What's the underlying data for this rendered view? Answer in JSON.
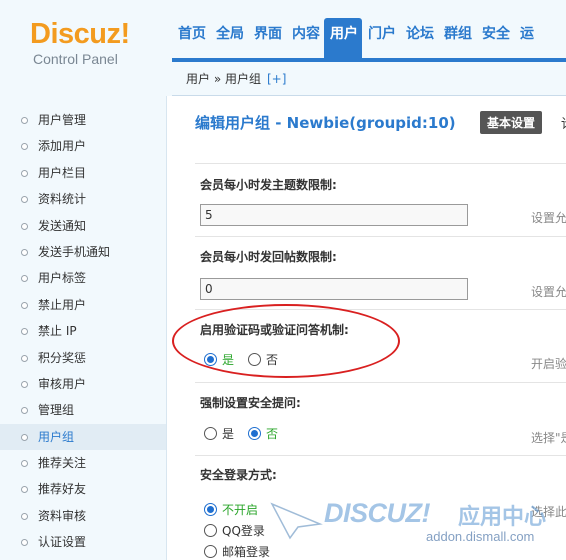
{
  "header": {
    "logo_brand": "Discuz!",
    "logo_sub": "Control Panel",
    "nav": [
      "首页",
      "全局",
      "界面",
      "内容",
      "用户",
      "门户",
      "论坛",
      "群组",
      "安全",
      "运"
    ],
    "active_nav": "用户",
    "breadcrumb": "用户 » 用户组",
    "breadcrumb_plus": "[+]"
  },
  "sidebar": {
    "items": [
      "用户管理",
      "添加用户",
      "用户栏目",
      "资料统计",
      "发送通知",
      "发送手机通知",
      "用户标签",
      "禁止用户",
      "禁止 IP",
      "积分奖惩",
      "审核用户",
      "管理组",
      "用户组",
      "推荐关注",
      "推荐好友",
      "资料审核",
      "认证设置"
    ],
    "active": "用户组"
  },
  "main": {
    "title": "编辑用户组 - Newbie(groupid:10)",
    "basic_button": "基本设置",
    "title_extra": "论",
    "fields": {
      "topic_limit": {
        "label": "会员每小时发主题数限制:",
        "value": "5",
        "hint": "设置允"
      },
      "reply_limit": {
        "label": "会员每小时发回帖数限制:",
        "value": "0",
        "hint": "设置允"
      },
      "captcha": {
        "label": "启用验证码或验证问答机制:",
        "yes": "是",
        "no": "否",
        "selected": "是",
        "hint": "开启验"
      },
      "security_question": {
        "label": "强制设置安全提问:",
        "yes": "是",
        "no": "否",
        "selected": "否",
        "hint": "选择\"是"
      },
      "login_method": {
        "label": "安全登录方式:",
        "options": [
          "不开启",
          "QQ登录",
          "邮箱登录"
        ],
        "selected": "不开启",
        "hint": "选择此"
      }
    }
  },
  "watermark": {
    "brand": "DISCUZ!",
    "cn": "应用中心",
    "url": "addon.dismall.com"
  },
  "colors": {
    "accent": "#2b7acd",
    "logo": "#f39b1f",
    "annotation": "#d92020",
    "checked_text": "#2aa52a"
  }
}
